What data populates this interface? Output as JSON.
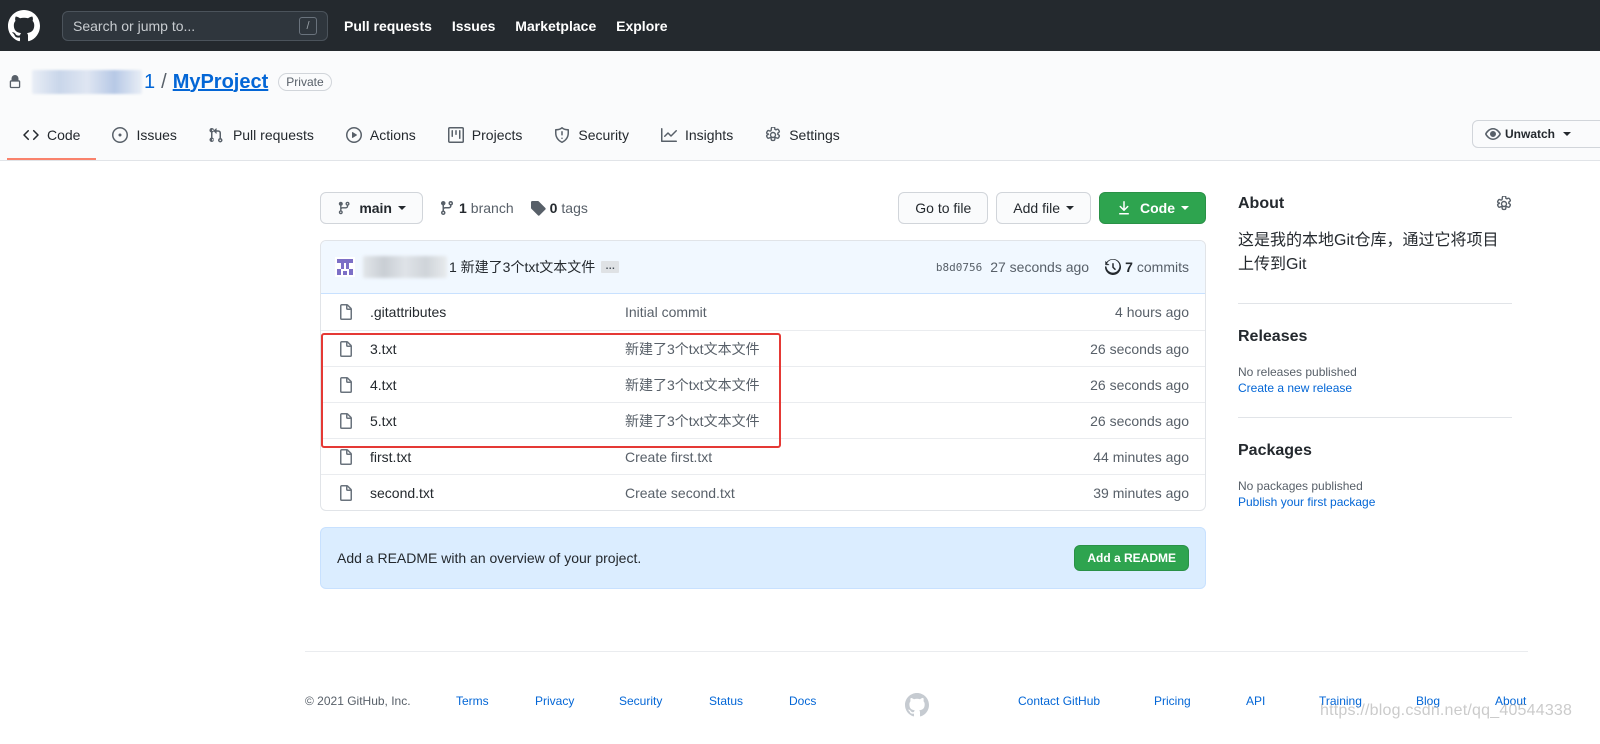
{
  "header": {
    "search_placeholder": "Search or jump to...",
    "search_shortcut": "/",
    "nav": [
      "Pull requests",
      "Issues",
      "Marketplace",
      "Explore"
    ]
  },
  "repo": {
    "owner_tail": "1",
    "separator": "/",
    "name": "MyProject",
    "visibility": "Private",
    "unwatch_label": "Unwatch"
  },
  "tabs": [
    "Code",
    "Issues",
    "Pull requests",
    "Actions",
    "Projects",
    "Security",
    "Insights",
    "Settings"
  ],
  "toolbar": {
    "branch": "main",
    "branch_count": "1",
    "branch_label": "branch",
    "tag_count": "0",
    "tag_label": "tags",
    "go_to_file": "Go to file",
    "add_file": "Add file",
    "code": "Code"
  },
  "latest_commit": {
    "message": "1 新建了3个txt文本文件",
    "ellipsis": "…",
    "sha": "b8d0756",
    "time": "27 seconds ago",
    "commit_count": "7",
    "commit_label": "commits"
  },
  "files": [
    {
      "name": ".gitattributes",
      "message": "Initial commit",
      "time": "4 hours ago"
    },
    {
      "name": "3.txt",
      "message": "新建了3个txt文本文件",
      "time": "26 seconds ago"
    },
    {
      "name": "4.txt",
      "message": "新建了3个txt文本文件",
      "time": "26 seconds ago"
    },
    {
      "name": "5.txt",
      "message": "新建了3个txt文本文件",
      "time": "26 seconds ago"
    },
    {
      "name": "first.txt",
      "message": "Create first.txt",
      "time": "44 minutes ago"
    },
    {
      "name": "second.txt",
      "message": "Create second.txt",
      "time": "39 minutes ago"
    }
  ],
  "readme": {
    "text": "Add a README with an overview of your project.",
    "button": "Add a README"
  },
  "sidebar": {
    "about_title": "About",
    "description": "这是我的本地Git仓库，通过它将项目上传到Git",
    "releases_title": "Releases",
    "releases_none": "No releases published",
    "releases_link": "Create a new release",
    "packages_title": "Packages",
    "packages_none": "No packages published",
    "packages_link": "Publish your first package"
  },
  "footer": {
    "copyright": "© 2021 GitHub, Inc.",
    "left_links": [
      "Terms",
      "Privacy",
      "Security",
      "Status",
      "Docs"
    ],
    "right_links": [
      "Contact GitHub",
      "Pricing",
      "API",
      "Training",
      "Blog",
      "About"
    ]
  },
  "watermark": "https://blog.csdn.net/qq_40544338",
  "colors": {
    "header_bg": "#24292e",
    "link": "#0366d6",
    "green": "#2ea44f",
    "tab_underline": "#f9826c",
    "highlight_red": "#e53935"
  }
}
